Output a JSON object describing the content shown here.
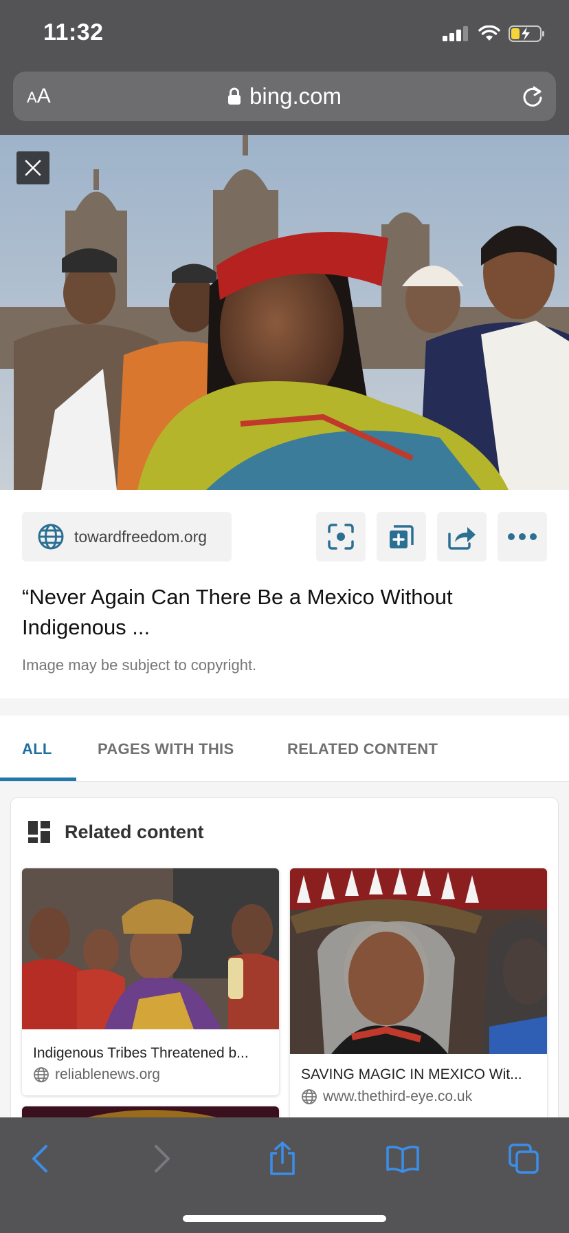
{
  "status_bar": {
    "time": "11:32"
  },
  "url_bar": {
    "text_size_label_small": "A",
    "text_size_label_large": "A",
    "url": "bing.com"
  },
  "image": {
    "source_domain": "towardfreedom.org",
    "title": "“Never Again Can There Be a Mexico Without Indigenous ...",
    "copyright_note": "Image may be subject to copyright."
  },
  "actions": [
    {
      "icon": "visual-search-icon"
    },
    {
      "icon": "add-collection-icon"
    },
    {
      "icon": "share-icon"
    },
    {
      "icon": "more-icon"
    }
  ],
  "tabs": [
    {
      "label": "ALL",
      "active": true
    },
    {
      "label": "PAGES WITH THIS",
      "active": false
    },
    {
      "label": "RELATED CONTENT",
      "active": false
    }
  ],
  "related": {
    "heading": "Related content",
    "items": [
      {
        "title": "Indigenous Tribes Threatened b...",
        "domain": "reliablenews.org"
      },
      {
        "title": "SAVING MAGIC IN MEXICO Wit...",
        "domain": "www.thethird-eye.co.uk"
      }
    ]
  },
  "colors": {
    "accent": "#2277ad",
    "chrome": "#545456",
    "toolbar_icon": "#3b8eea"
  }
}
